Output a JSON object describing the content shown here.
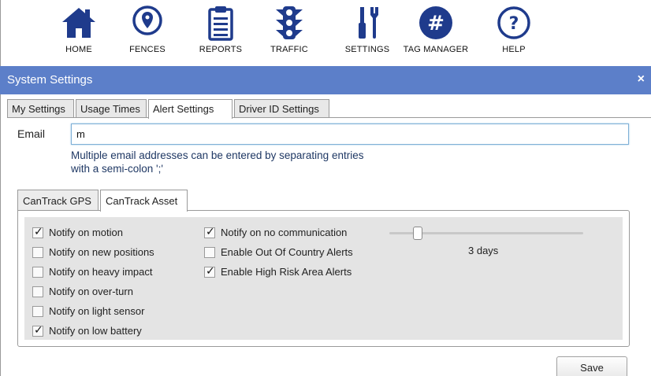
{
  "toolbar": {
    "items": [
      {
        "label": "HOME",
        "icon": "home-icon"
      },
      {
        "label": "FENCES",
        "icon": "map-pin-icon"
      },
      {
        "label": "REPORTS",
        "icon": "clipboard-icon"
      },
      {
        "label": "TRAFFIC",
        "icon": "traffic-light-icon"
      },
      {
        "label": "SETTINGS",
        "icon": "tools-icon"
      },
      {
        "label": "TAG MANAGER",
        "icon": "hashtag-icon"
      },
      {
        "label": "HELP",
        "icon": "question-icon"
      }
    ],
    "icon_color": "#1f3b8c"
  },
  "window": {
    "title": "System Settings",
    "close": "×",
    "title_bg": "#5c7fc9"
  },
  "tabs": [
    "My Settings",
    "Usage Times",
    "Alert Settings",
    "Driver ID Settings"
  ],
  "active_tab": "Alert Settings",
  "email": {
    "label": "Email",
    "value": "m",
    "hint_line1": "Multiple email addresses can be entered by separating entries",
    "hint_line2": "with a semi-colon ';'"
  },
  "subtabs": [
    "CanTrack GPS",
    "CanTrack Asset"
  ],
  "active_subtab": "CanTrack Asset",
  "alerts": {
    "left": [
      {
        "label": "Notify on motion",
        "checked": true
      },
      {
        "label": "Notify on new positions",
        "checked": false
      },
      {
        "label": "Notify on heavy impact",
        "checked": false
      },
      {
        "label": "Notify on over-turn",
        "checked": false
      },
      {
        "label": "Notify on light sensor",
        "checked": false
      },
      {
        "label": "Notify on low battery",
        "checked": true
      }
    ],
    "right": [
      {
        "label": "Notify on no communication",
        "checked": true
      },
      {
        "label": "Enable Out Of Country Alerts",
        "checked": false
      },
      {
        "label": "Enable High Risk Area Alerts",
        "checked": true
      }
    ],
    "slider_value": "3 days"
  },
  "save_label": "Save"
}
